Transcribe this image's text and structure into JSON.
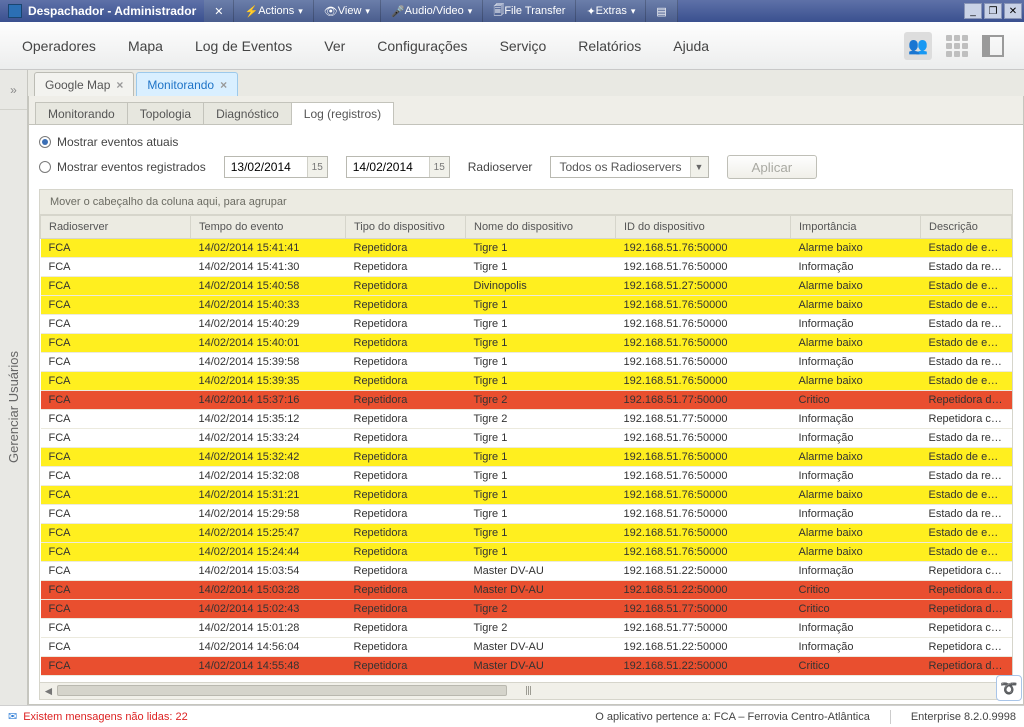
{
  "rc": {
    "title": "Despachador - Administrador",
    "actions": "Actions",
    "view": "View",
    "audio": "Audio/Video",
    "ft": "File Transfer",
    "extras": "Extras"
  },
  "menu": {
    "operadores": "Operadores",
    "mapa": "Mapa",
    "log": "Log de Eventos",
    "ver": "Ver",
    "config": "Configurações",
    "servico": "Serviço",
    "relatorios": "Relatórios",
    "ajuda": "Ajuda"
  },
  "rail": {
    "label": "Gerenciar Usuários"
  },
  "outer_tabs": {
    "google": "Google Map",
    "monitor": "Monitorando"
  },
  "sub_tabs": {
    "monitor": "Monitorando",
    "topologia": "Topologia",
    "diag": "Diagnóstico",
    "log": "Log (registros)"
  },
  "filters": {
    "current": "Mostrar eventos atuais",
    "registered": "Mostrar eventos registrados",
    "date1": "13/02/2014",
    "date2": "14/02/2014",
    "radioserver_label": "Radioserver",
    "radioserver_value": "Todos os Radioservers",
    "apply": "Aplicar",
    "group_hint": "Mover o cabeçalho da coluna aqui, para agrupar"
  },
  "columns": {
    "c1": "Radioserver",
    "c2": "Tempo do evento",
    "c3": "Tipo do dispositivo",
    "c4": "Nome do dispositivo",
    "c5": "ID do dispositivo",
    "c6": "Importância",
    "c7": "Descrição"
  },
  "rows": [
    {
      "sev": "yellow",
      "c1": "FCA",
      "c2": "14/02/2014 15:41:41",
      "c3": "Repetidora",
      "c4": "Tigre 1",
      "c5": "192.168.51.76:50000",
      "c6": "Alarme baixo",
      "c7": "Estado de emerg"
    },
    {
      "sev": "white",
      "c1": "FCA",
      "c2": "14/02/2014 15:41:30",
      "c3": "Repetidora",
      "c4": "Tigre 1",
      "c5": "192.168.51.76:50000",
      "c6": "Informação",
      "c7": "Estado da repeti"
    },
    {
      "sev": "yellow",
      "c1": "FCA",
      "c2": "14/02/2014 15:40:58",
      "c3": "Repetidora",
      "c4": "Divinopolis",
      "c5": "192.168.51.27:50000",
      "c6": "Alarme baixo",
      "c7": "Estado de emerg"
    },
    {
      "sev": "yellow",
      "c1": "FCA",
      "c2": "14/02/2014 15:40:33",
      "c3": "Repetidora",
      "c4": "Tigre 1",
      "c5": "192.168.51.76:50000",
      "c6": "Alarme baixo",
      "c7": "Estado de emerg"
    },
    {
      "sev": "white",
      "c1": "FCA",
      "c2": "14/02/2014 15:40:29",
      "c3": "Repetidora",
      "c4": "Tigre 1",
      "c5": "192.168.51.76:50000",
      "c6": "Informação",
      "c7": "Estado da repeti"
    },
    {
      "sev": "yellow",
      "c1": "FCA",
      "c2": "14/02/2014 15:40:01",
      "c3": "Repetidora",
      "c4": "Tigre 1",
      "c5": "192.168.51.76:50000",
      "c6": "Alarme baixo",
      "c7": "Estado de emerg"
    },
    {
      "sev": "white",
      "c1": "FCA",
      "c2": "14/02/2014 15:39:58",
      "c3": "Repetidora",
      "c4": "Tigre 1",
      "c5": "192.168.51.76:50000",
      "c6": "Informação",
      "c7": "Estado da repeti"
    },
    {
      "sev": "yellow",
      "c1": "FCA",
      "c2": "14/02/2014 15:39:35",
      "c3": "Repetidora",
      "c4": "Tigre 1",
      "c5": "192.168.51.76:50000",
      "c6": "Alarme baixo",
      "c7": "Estado de emerg"
    },
    {
      "sev": "red",
      "c1": "FCA",
      "c2": "14/02/2014 15:37:16",
      "c3": "Repetidora",
      "c4": "Tigre 2",
      "c5": "192.168.51.77:50000",
      "c6": "Critico",
      "c7": "Repetidora desco"
    },
    {
      "sev": "white",
      "c1": "FCA",
      "c2": "14/02/2014 15:35:12",
      "c3": "Repetidora",
      "c4": "Tigre 2",
      "c5": "192.168.51.77:50000",
      "c6": "Informação",
      "c7": "Repetidora cone"
    },
    {
      "sev": "white",
      "c1": "FCA",
      "c2": "14/02/2014 15:33:24",
      "c3": "Repetidora",
      "c4": "Tigre 1",
      "c5": "192.168.51.76:50000",
      "c6": "Informação",
      "c7": "Estado da repeti"
    },
    {
      "sev": "yellow",
      "c1": "FCA",
      "c2": "14/02/2014 15:32:42",
      "c3": "Repetidora",
      "c4": "Tigre 1",
      "c5": "192.168.51.76:50000",
      "c6": "Alarme baixo",
      "c7": "Estado de emerg"
    },
    {
      "sev": "white",
      "c1": "FCA",
      "c2": "14/02/2014 15:32:08",
      "c3": "Repetidora",
      "c4": "Tigre 1",
      "c5": "192.168.51.76:50000",
      "c6": "Informação",
      "c7": "Estado da repeti"
    },
    {
      "sev": "yellow",
      "c1": "FCA",
      "c2": "14/02/2014 15:31:21",
      "c3": "Repetidora",
      "c4": "Tigre 1",
      "c5": "192.168.51.76:50000",
      "c6": "Alarme baixo",
      "c7": "Estado de emerg"
    },
    {
      "sev": "white",
      "c1": "FCA",
      "c2": "14/02/2014 15:29:58",
      "c3": "Repetidora",
      "c4": "Tigre 1",
      "c5": "192.168.51.76:50000",
      "c6": "Informação",
      "c7": "Estado da repeti"
    },
    {
      "sev": "yellow",
      "c1": "FCA",
      "c2": "14/02/2014 15:25:47",
      "c3": "Repetidora",
      "c4": "Tigre 1",
      "c5": "192.168.51.76:50000",
      "c6": "Alarme baixo",
      "c7": "Estado de emerg"
    },
    {
      "sev": "yellow",
      "c1": "FCA",
      "c2": "14/02/2014 15:24:44",
      "c3": "Repetidora",
      "c4": "Tigre 1",
      "c5": "192.168.51.76:50000",
      "c6": "Alarme baixo",
      "c7": "Estado de emerg"
    },
    {
      "sev": "white",
      "c1": "FCA",
      "c2": "14/02/2014 15:03:54",
      "c3": "Repetidora",
      "c4": "Master DV-AU",
      "c5": "192.168.51.22:50000",
      "c6": "Informação",
      "c7": "Repetidora cone"
    },
    {
      "sev": "red",
      "c1": "FCA",
      "c2": "14/02/2014 15:03:28",
      "c3": "Repetidora",
      "c4": "Master DV-AU",
      "c5": "192.168.51.22:50000",
      "c6": "Critico",
      "c7": "Repetidora desco"
    },
    {
      "sev": "red",
      "c1": "FCA",
      "c2": "14/02/2014 15:02:43",
      "c3": "Repetidora",
      "c4": "Tigre 2",
      "c5": "192.168.51.77:50000",
      "c6": "Critico",
      "c7": "Repetidora desco"
    },
    {
      "sev": "white",
      "c1": "FCA",
      "c2": "14/02/2014 15:01:28",
      "c3": "Repetidora",
      "c4": "Tigre 2",
      "c5": "192.168.51.77:50000",
      "c6": "Informação",
      "c7": "Repetidora cone"
    },
    {
      "sev": "white",
      "c1": "FCA",
      "c2": "14/02/2014 14:56:04",
      "c3": "Repetidora",
      "c4": "Master DV-AU",
      "c5": "192.168.51.22:50000",
      "c6": "Informação",
      "c7": "Repetidora cone"
    },
    {
      "sev": "red",
      "c1": "FCA",
      "c2": "14/02/2014 14:55:48",
      "c3": "Repetidora",
      "c4": "Master DV-AU",
      "c5": "192.168.51.22:50000",
      "c6": "Critico",
      "c7": "Repetidora desco"
    }
  ],
  "status": {
    "unread": "Existem mensagens não lidas: 22",
    "owner": "O aplicativo pertence a:   FCA – Ferrovia Centro-Atlântica",
    "version": "Enterprise 8.2.0.9998"
  }
}
